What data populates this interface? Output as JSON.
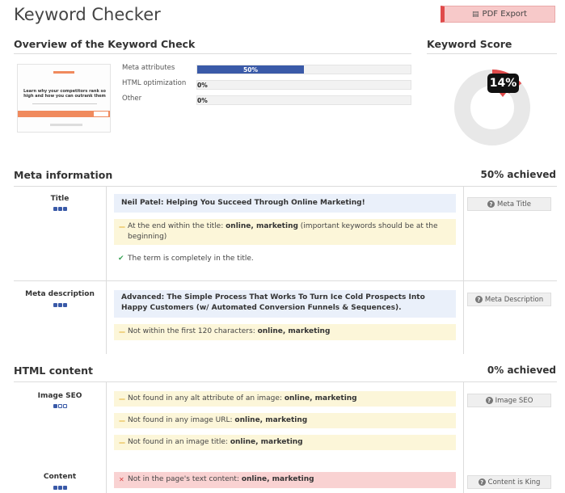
{
  "page_title": "Keyword Checker",
  "pdf_button": {
    "label": "PDF Export",
    "icon": "document-icon"
  },
  "overview": {
    "heading": "Overview of the Keyword Check",
    "thumbnail": {
      "logo": "NEILPATEL",
      "headline": "Learn why your competitors rank so high and how you can outrank them"
    },
    "metrics": [
      {
        "label": "Meta attributes",
        "value": "50%",
        "fraction": 0.5
      },
      {
        "label": "HTML optimization",
        "value": "0%",
        "fraction": 0
      },
      {
        "label": "Other",
        "value": "0%",
        "fraction": 0
      }
    ]
  },
  "keyword_score": {
    "heading": "Keyword Score",
    "value": "14%",
    "fraction": 0.14,
    "colors": {
      "track": "#e8e8e8",
      "fill": "#e04b4b"
    }
  },
  "meta_info": {
    "heading": "Meta information",
    "achieved": "50% achieved",
    "title_row": {
      "label": "Title",
      "value": "Neil Patel: Helping You Succeed Through Online Marketing!",
      "warning_prefix": "At the end within the title: ",
      "warning_keywords": "online, marketing",
      "warning_suffix": " (important keywords should be at the beginning)",
      "success": "The term is completely in the title.",
      "button": "Meta Title"
    },
    "description_row": {
      "label": "Meta description",
      "value": "Advanced: The Simple Process That Works To Turn Ice Cold Prospects Into Happy Customers (w/ Automated Conversion Funnels & Sequences).",
      "warning_prefix": "Not within the first 120 characters: ",
      "warning_keywords": "online, marketing",
      "button": "Meta Description"
    }
  },
  "html_content": {
    "heading": "HTML content",
    "achieved": "0% achieved",
    "image_seo": {
      "label": "Image SEO",
      "items": [
        {
          "prefix": "Not found in any alt attribute of an image: ",
          "keywords": "online, marketing"
        },
        {
          "prefix": "Not found in any image URL: ",
          "keywords": "online, marketing"
        },
        {
          "prefix": "Not found in an image title: ",
          "keywords": "online, marketing"
        }
      ],
      "button": "Image SEO"
    },
    "content": {
      "label": "Content",
      "error_prefix": "Not in the page's text content: ",
      "error_keywords": "online, marketing",
      "button": "Content is King"
    }
  }
}
